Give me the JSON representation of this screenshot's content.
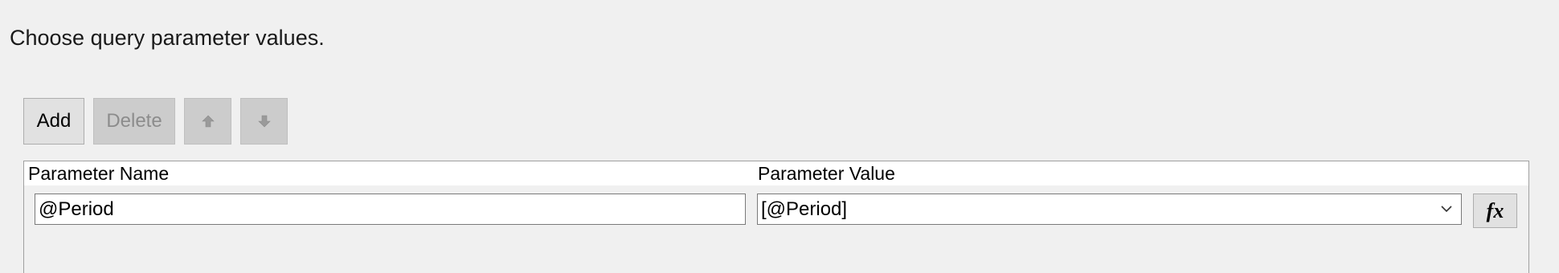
{
  "instruction": "Choose query parameter values.",
  "toolbar": {
    "add_label": "Add",
    "delete_label": "Delete",
    "move_up_icon": "arrow-up-icon",
    "move_down_icon": "arrow-down-icon"
  },
  "grid": {
    "columns": [
      "Parameter Name",
      "Parameter Value"
    ],
    "rows": [
      {
        "name": "@Period",
        "value": "[@Period]",
        "expression_button": "fx"
      }
    ]
  },
  "colors": {
    "background": "#f0f0f0",
    "button_face": "#e1e1e1",
    "disabled_button_face": "#cccccc",
    "disabled_text": "#8c8c8c",
    "border": "#adadad"
  }
}
